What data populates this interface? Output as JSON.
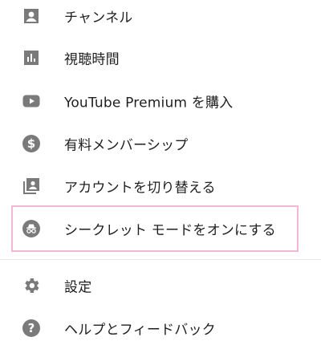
{
  "menu": {
    "items": [
      {
        "label": "チャンネル",
        "icon": "account-box-icon"
      },
      {
        "label": "視聴時間",
        "icon": "bar-chart-icon"
      },
      {
        "label": "YouTube Premium を購入",
        "icon": "youtube-play-icon"
      },
      {
        "label": "有料メンバーシップ",
        "icon": "dollar-icon"
      },
      {
        "label": "アカウントを切り替える",
        "icon": "switch-account-icon"
      },
      {
        "label": "シークレット モードをオンにする",
        "icon": "incognito-icon"
      },
      {
        "label": "設定",
        "icon": "gear-icon"
      },
      {
        "label": "ヘルプとフィードバック",
        "icon": "help-icon"
      }
    ]
  },
  "colors": {
    "icon": "#7a7a7a",
    "text": "#1f1f1f",
    "highlight_border": "#f3b6d4",
    "divider": "#e6e6e6"
  }
}
